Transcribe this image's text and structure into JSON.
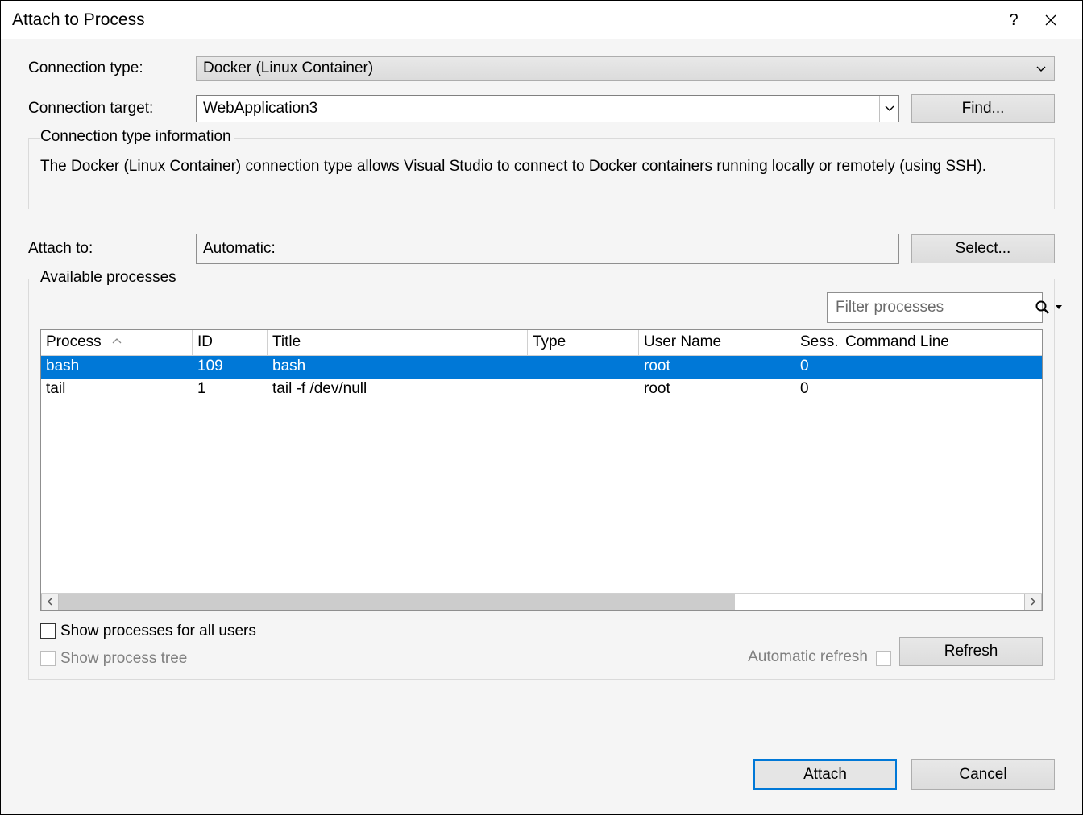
{
  "titlebar": {
    "title": "Attach to Process",
    "help": "?",
    "close": "✕"
  },
  "connection_type": {
    "label": "Connection type:",
    "value": "Docker (Linux Container)"
  },
  "connection_target": {
    "label": "Connection target:",
    "value": "WebApplication3",
    "find_label": "Find..."
  },
  "info": {
    "title": "Connection type information",
    "text": "The Docker (Linux Container) connection type allows Visual Studio to connect to Docker containers running locally or remotely (using SSH)."
  },
  "attach_to": {
    "label": "Attach to:",
    "value": "Automatic:",
    "select_label": "Select..."
  },
  "processes": {
    "title": "Available processes",
    "filter_placeholder": "Filter processes",
    "columns": {
      "process": "Process",
      "id": "ID",
      "title": "Title",
      "type": "Type",
      "user": "User Name",
      "session": "Sess...",
      "cmd": "Command Line"
    },
    "rows": [
      {
        "process": "bash",
        "id": "109",
        "title": "bash",
        "type": "",
        "user": "root",
        "session": "0",
        "cmd": "",
        "selected": true
      },
      {
        "process": "tail",
        "id": "1",
        "title": "tail -f /dev/null",
        "type": "",
        "user": "root",
        "session": "0",
        "cmd": "",
        "selected": false
      }
    ],
    "show_all_users": "Show processes for all users",
    "show_tree": "Show process tree",
    "auto_refresh": "Automatic refresh",
    "refresh_label": "Refresh"
  },
  "buttons": {
    "attach": "Attach",
    "cancel": "Cancel"
  }
}
